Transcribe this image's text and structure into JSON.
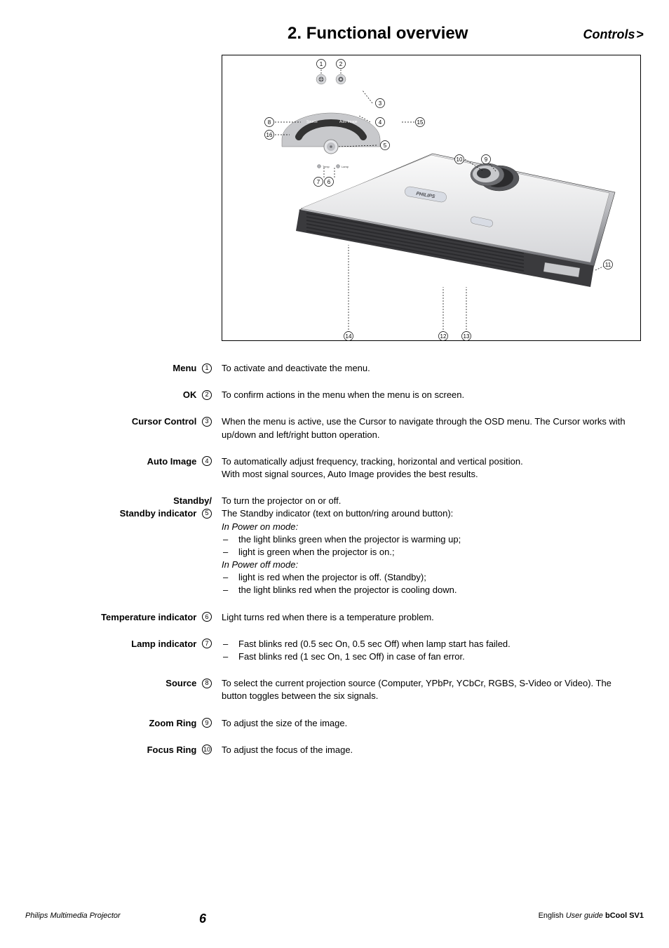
{
  "header": {
    "title": "2. Functional overview",
    "section": "Controls",
    "gt": ">"
  },
  "diagram": {
    "callouts": [
      "1",
      "2",
      "3",
      "4",
      "5",
      "6",
      "7",
      "8",
      "9",
      "10",
      "11",
      "12",
      "13",
      "14",
      "15",
      "16"
    ],
    "buttons": {
      "source": "Source",
      "autoimage": "Auto Image"
    }
  },
  "entries": [
    {
      "label": "Menu",
      "num": "1",
      "body": [
        {
          "type": "text",
          "value": "To activate and deactivate the menu."
        }
      ]
    },
    {
      "label": "OK",
      "num": "2",
      "body": [
        {
          "type": "text",
          "value": "To confirm actions in the menu when the menu is on screen."
        }
      ]
    },
    {
      "label": "Cursor Control",
      "num": "3",
      "body": [
        {
          "type": "text",
          "value": "When the menu is active, use the Cursor to navigate through the OSD menu. The Cursor works with up/down and left/right button operation."
        }
      ]
    },
    {
      "label": "Auto Image",
      "num": "4",
      "body": [
        {
          "type": "text",
          "value": "To automatically adjust frequency, tracking, horizontal and vertical position."
        },
        {
          "type": "text",
          "value": "With most signal sources, Auto Image provides the best results."
        }
      ]
    },
    {
      "label": "Standby/",
      "label2": "Standby indicator",
      "num": "5",
      "body": [
        {
          "type": "text",
          "value": "To turn the projector on or off."
        },
        {
          "type": "text",
          "value": "The Standby indicator (text on button/ring around button):"
        },
        {
          "type": "italic",
          "value": "In Power on mode:"
        },
        {
          "type": "dash",
          "value": "the light blinks green when the projector is warming up;"
        },
        {
          "type": "dash",
          "value": "light is green when the projector is on.;"
        },
        {
          "type": "italic",
          "value": "In Power off mode:"
        },
        {
          "type": "dash",
          "value": "light is red when the projector is off. (Standby);"
        },
        {
          "type": "dash",
          "value": "the light blinks red when the projector is cooling down."
        }
      ]
    },
    {
      "label": "Temperature indicator",
      "num": "6",
      "body": [
        {
          "type": "text",
          "value": "Light turns red when there is a temperature problem."
        }
      ]
    },
    {
      "label": "Lamp indicator",
      "num": "7",
      "body": [
        {
          "type": "dash",
          "value": "Fast blinks red (0.5 sec On, 0.5 sec Off) when lamp start has failed."
        },
        {
          "type": "dash",
          "value": "Fast blinks red (1 sec On, 1 sec Off) in case of fan error."
        }
      ]
    },
    {
      "label": "Source",
      "num": "8",
      "body": [
        {
          "type": "text",
          "value": "To select the current projection source (Computer, YPbPr, YCbCr, RGBS, S-Video or Video). The button toggles between the six signals."
        }
      ]
    },
    {
      "label": "Zoom Ring",
      "num": "9",
      "body": [
        {
          "type": "text",
          "value": "To adjust the size of the image."
        }
      ]
    },
    {
      "label": "Focus Ring",
      "num": "10",
      "body": [
        {
          "type": "text",
          "value": "To adjust the focus of the image."
        }
      ]
    }
  ],
  "footer": {
    "left": "Philips Multimedia Projector",
    "page": "6",
    "right_lang": "English",
    "right_guide": "User guide",
    "right_model": "bCool SV1"
  }
}
